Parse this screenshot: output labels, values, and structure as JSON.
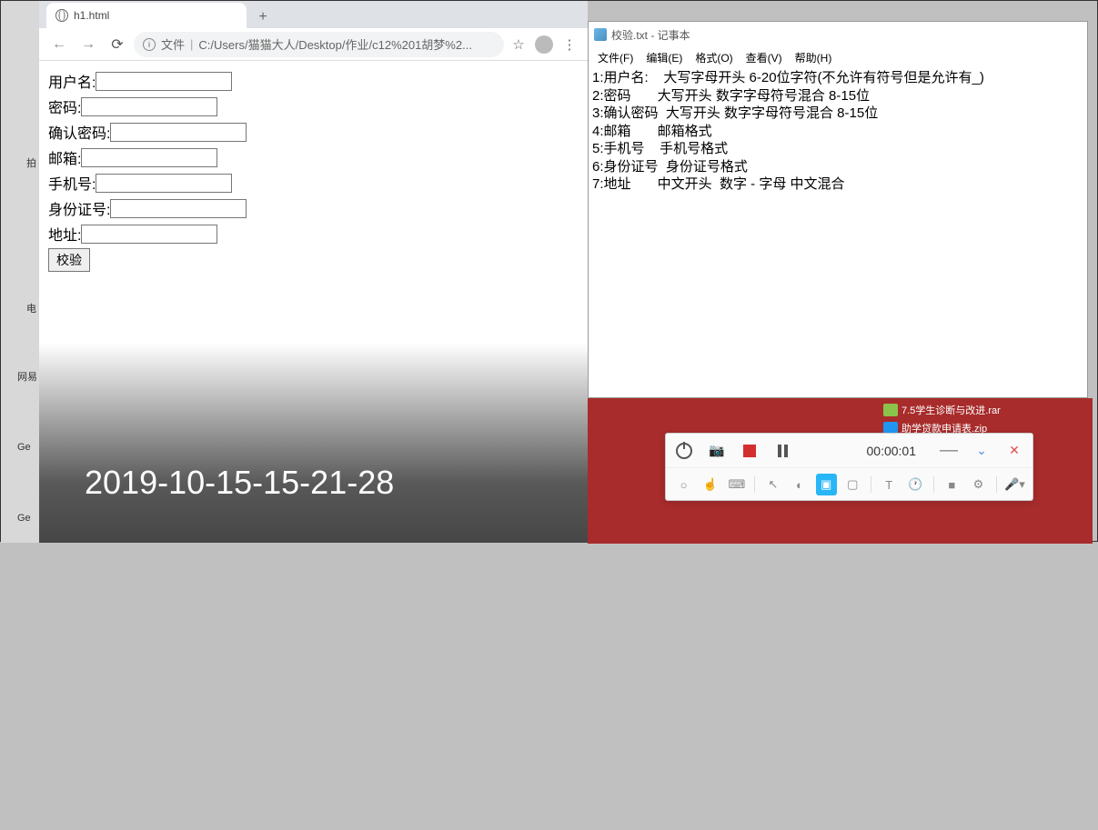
{
  "chrome": {
    "tab_title": "h1.html",
    "url_prefix": "文件",
    "url": "C:/Users/猫猫大人/Desktop/作业/c12%201胡梦%2...",
    "form": {
      "username_label": "用户名:",
      "password_label": "密码:",
      "confirm_label": "确认密码:",
      "email_label": "邮箱:",
      "phone_label": "手机号:",
      "idcard_label": "身份证号:",
      "address_label": "地址:",
      "submit_label": "校验"
    }
  },
  "notepad": {
    "title": "校验.txt - 记事本",
    "menu": {
      "file": "文件(F)",
      "edit": "编辑(E)",
      "format": "格式(O)",
      "view": "查看(V)",
      "help": "帮助(H)"
    },
    "lines": {
      "l1": "1:用户名:    大写字母开头 6-20位字符(不允许有符号但是允许有_)",
      "l2": "2:密码       大写开头 数字字母符号混合 8-15位",
      "l3": "3:确认密码  大写开头 数字字母符号混合 8-15位",
      "l4": "4:邮箱       邮箱格式",
      "l5": "5:手机号    手机号格式",
      "l6": "6:身份证号  身份证号格式",
      "l7": "7:地址       中文开头  数字 - 字母 中文混合"
    }
  },
  "recorder": {
    "time": "00:00:01"
  },
  "timestamp": "2019-10-15-15-21-28",
  "desktop": {
    "file1": "7.5学生诊断与改进.rar",
    "file2": "助学贷款申请表.zip"
  },
  "sidebar": {
    "l1": "拍",
    "l2": "电",
    "l3": "网易",
    "l4": "Ge",
    "l5": "Ge"
  }
}
